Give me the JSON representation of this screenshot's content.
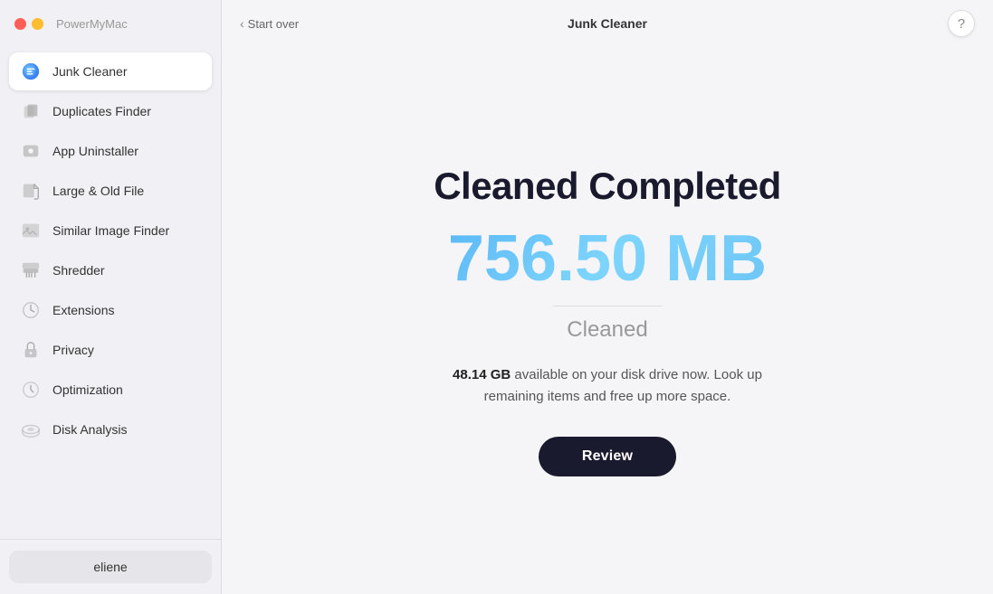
{
  "app": {
    "name": "PowerMyMac"
  },
  "titlebar": {
    "back_label": "Start over",
    "title": "Junk Cleaner",
    "help_label": "?"
  },
  "sidebar": {
    "items": [
      {
        "id": "junk-cleaner",
        "label": "Junk Cleaner",
        "active": true
      },
      {
        "id": "duplicates-finder",
        "label": "Duplicates Finder",
        "active": false
      },
      {
        "id": "app-uninstaller",
        "label": "App Uninstaller",
        "active": false
      },
      {
        "id": "large-old-file",
        "label": "Large & Old File",
        "active": false
      },
      {
        "id": "similar-image-finder",
        "label": "Similar Image Finder",
        "active": false
      },
      {
        "id": "shredder",
        "label": "Shredder",
        "active": false
      },
      {
        "id": "extensions",
        "label": "Extensions",
        "active": false
      },
      {
        "id": "privacy",
        "label": "Privacy",
        "active": false
      },
      {
        "id": "optimization",
        "label": "Optimization",
        "active": false
      },
      {
        "id": "disk-analysis",
        "label": "Disk Analysis",
        "active": false
      }
    ],
    "user_label": "eliene"
  },
  "main": {
    "cleaned_title": "Cleaned Completed",
    "cleaned_size": "756.50 MB",
    "cleaned_label": "Cleaned",
    "disk_gb": "48.14 GB",
    "disk_info_suffix": " available on your disk drive now. Look up remaining items and free up more space.",
    "review_button": "Review"
  },
  "colors": {
    "accent_blue": "#5bb8f5",
    "dark_navy": "#1a1a2e"
  }
}
